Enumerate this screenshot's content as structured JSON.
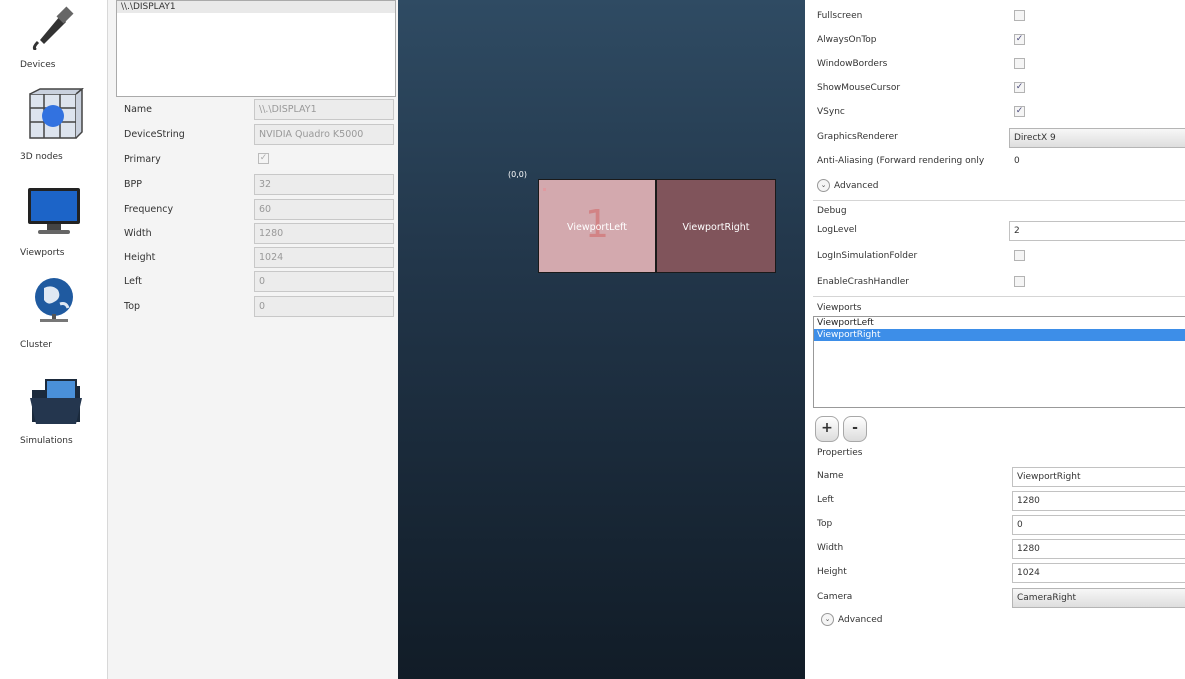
{
  "nav": {
    "items": [
      {
        "label": "Devices",
        "icon": "usb-plug-icon"
      },
      {
        "label": "3D nodes",
        "icon": "cube-grid-icon"
      },
      {
        "label": "Viewports",
        "icon": "monitor-icon"
      },
      {
        "label": "Cluster",
        "icon": "globe-network-icon"
      },
      {
        "label": "Simulations",
        "icon": "folder-icon"
      }
    ]
  },
  "display": {
    "list": [
      "\\\\.\\DISPLAY1"
    ],
    "props": [
      {
        "key": "Name",
        "value": "\\\\.\\DISPLAY1"
      },
      {
        "key": "DeviceString",
        "value": "NVIDIA Quadro K5000"
      },
      {
        "key": "Primary",
        "value": "✓"
      },
      {
        "key": "BPP",
        "value": "32"
      },
      {
        "key": "Frequency",
        "value": "60"
      },
      {
        "key": "Width",
        "value": "1280"
      },
      {
        "key": "Height",
        "value": "1024"
      },
      {
        "key": "Left",
        "value": "0"
      },
      {
        "key": "Top",
        "value": "0"
      }
    ]
  },
  "canvas": {
    "origin": "(0,0)",
    "viewport_left": {
      "label": "ViewportLeft",
      "number": "1"
    },
    "viewport_right": {
      "label": "ViewportRight"
    }
  },
  "window": {
    "fullscreen_label": "Fullscreen",
    "fullscreen": "",
    "always_on_top_label": "AlwaysOnTop",
    "always_on_top": "✓",
    "window_borders_label": "WindowBorders",
    "window_borders": "",
    "show_mouse_label": "ShowMouseCursor",
    "show_mouse": "✓",
    "vsync_label": "VSync",
    "vsync": "✓",
    "renderer_label": "GraphicsRenderer",
    "renderer": "DirectX 9",
    "aa_label": "Anti-Aliasing (Forward rendering only",
    "aa": "0",
    "advanced": "Advanced"
  },
  "debug": {
    "header": "Debug",
    "log_level_label": "LogLevel",
    "log_level": "2",
    "log_folder_label": "LogInSimulationFolder",
    "log_folder": "",
    "crash_label": "EnableCrashHandler",
    "crash": ""
  },
  "viewports": {
    "header": "Viewports",
    "items": [
      "ViewportLeft",
      "ViewportRight"
    ],
    "add": "+",
    "remove": "-"
  },
  "properties": {
    "header": "Properties",
    "name_label": "Name",
    "name": "ViewportRight",
    "left_label": "Left",
    "left": "1280",
    "top_label": "Top",
    "top": "0",
    "width_label": "Width",
    "width": "1280",
    "height_label": "Height",
    "height": "1024",
    "camera_label": "Camera",
    "camera": "CameraRight",
    "advanced": "Advanced"
  }
}
